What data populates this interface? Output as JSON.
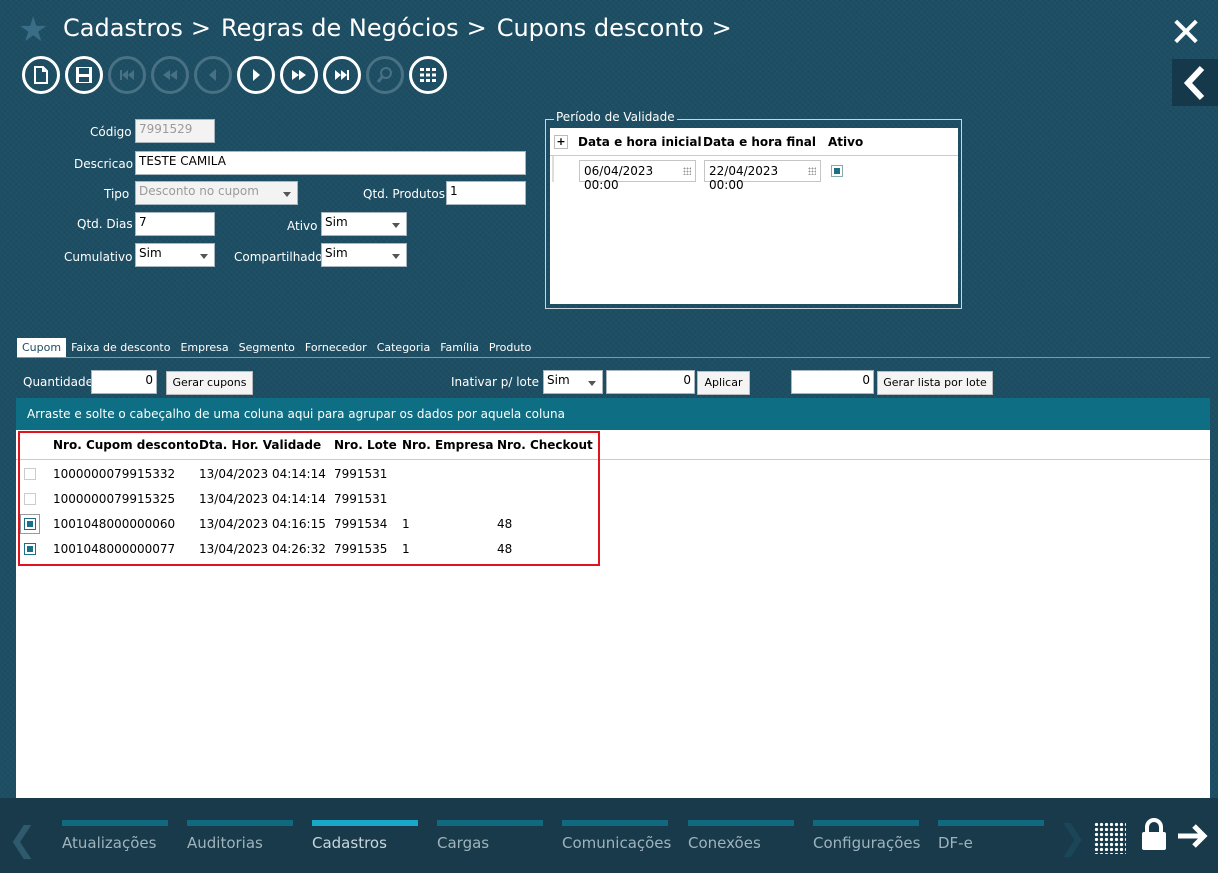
{
  "breadcrumb": {
    "items": [
      "Cadastros",
      "Regras de Negócios",
      "Cupons desconto"
    ]
  },
  "form": {
    "codigo_label": "Código",
    "codigo_value": "7991529",
    "descricao_label": "Descricao",
    "descricao_value": "TESTE CAMILA",
    "tipo_label": "Tipo",
    "tipo_value": "Desconto no cupom",
    "qtd_produtos_label": "Qtd. Produtos",
    "qtd_produtos_value": "1",
    "qtd_dias_label": "Qtd. Dias",
    "qtd_dias_value": "7",
    "ativo_label": "Ativo",
    "ativo_value": "Sim",
    "cumulativo_label": "Cumulativo",
    "cumulativo_value": "Sim",
    "compartilhado_label": "Compartilhado",
    "compartilhado_value": "Sim"
  },
  "validade": {
    "title": "Período de Validade",
    "plus": "+",
    "col_inicial": "Data e hora inicial",
    "col_final": "Data e hora final",
    "col_ativo": "Ativo",
    "row": {
      "inicial": "06/04/2023 00:00",
      "final": "22/04/2023 00:00",
      "ativo": true
    }
  },
  "tabs": [
    "Cupom",
    "Faixa de desconto",
    "Empresa",
    "Segmento",
    "Fornecedor",
    "Categoria",
    "Família",
    "Produto"
  ],
  "actions": {
    "quantidade_label": "Quantidade",
    "quantidade_value": "0",
    "gerar_cupons": "Gerar cupons",
    "inativar_label": "Inativar p/ lote",
    "inativar_value": "Sim",
    "lote_value": "0",
    "aplicar": "Aplicar",
    "lista_value": "0",
    "gerar_lista": "Gerar lista por lote"
  },
  "grid": {
    "group_hint": "Arraste e solte o cabeçalho de uma coluna aqui para agrupar os dados por aquela coluna",
    "columns": [
      "Nro. Cupom desconto",
      "Dta. Hor. Validade",
      "Nro. Lote",
      "Nro. Empresa",
      "Nro. Checkout"
    ],
    "rows": [
      {
        "cupom": "1000000079915332",
        "validade": "13/04/2023 04:14:14",
        "lote": "7991531",
        "empresa": "",
        "checkout": "",
        "checked": false
      },
      {
        "cupom": "1000000079915325",
        "validade": "13/04/2023 04:14:14",
        "lote": "7991531",
        "empresa": "",
        "checkout": "",
        "checked": false
      },
      {
        "cupom": "1001048000000060",
        "validade": "13/04/2023 04:16:15",
        "lote": "7991534",
        "empresa": "1",
        "checkout": "48",
        "checked": true
      },
      {
        "cupom": "1001048000000077",
        "validade": "13/04/2023 04:26:32",
        "lote": "7991535",
        "empresa": "1",
        "checkout": "48",
        "checked": true
      }
    ]
  },
  "bottom_nav": {
    "items": [
      "Atualizações",
      "Auditorias",
      "Cadastros",
      "Cargas",
      "Comunicações",
      "Conexões",
      "Configurações",
      "DF-e"
    ],
    "active": "Cadastros"
  },
  "colors": {
    "background": "#1d4e63",
    "grid_header": "#0e6e83",
    "highlight": "#e0141e",
    "nav_active": "#19a7c9"
  }
}
